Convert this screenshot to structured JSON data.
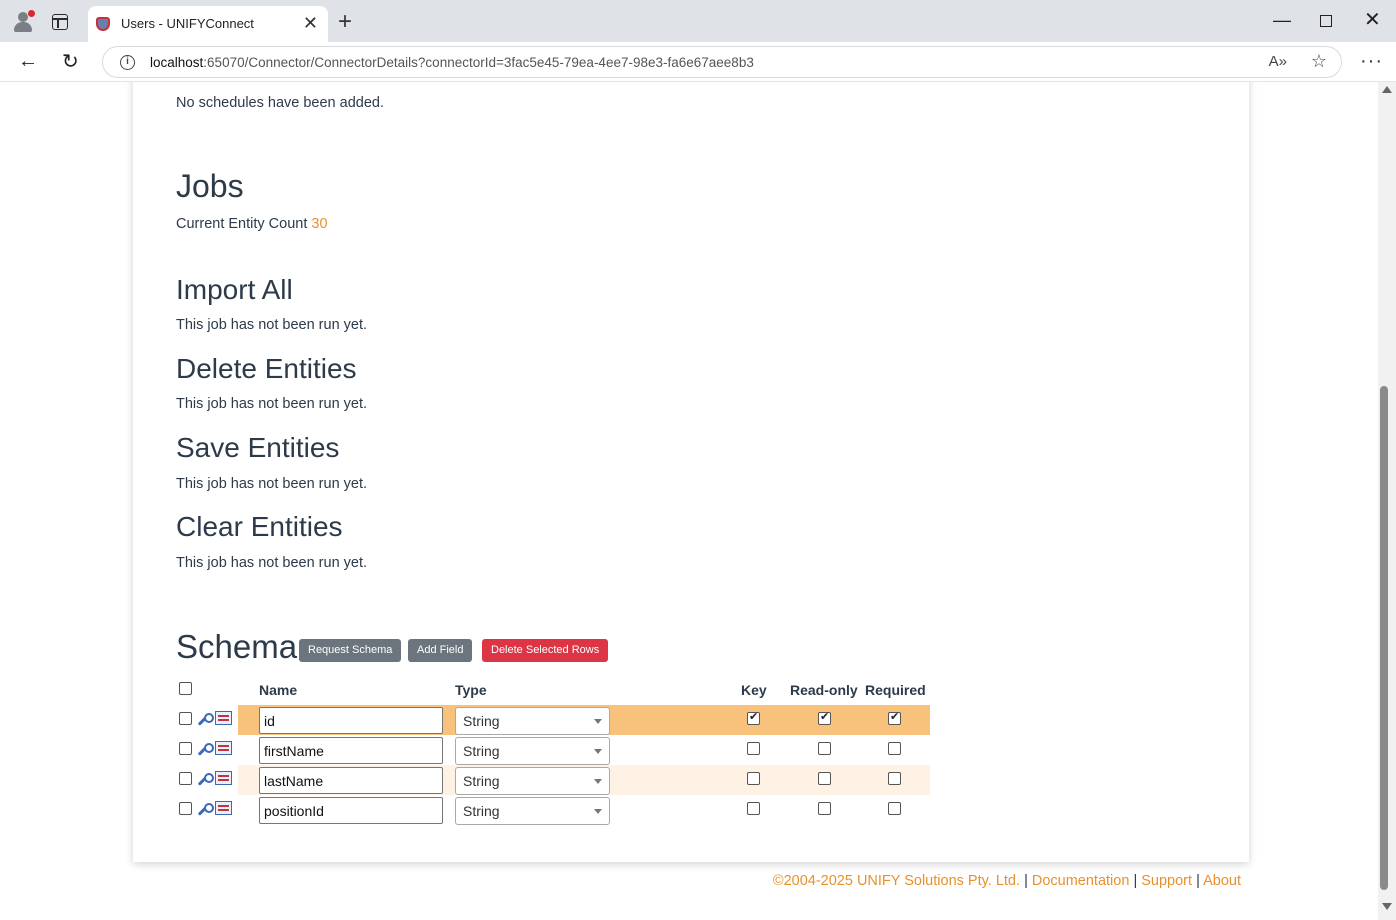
{
  "browser": {
    "tab_title": "Users - UNIFYConnect",
    "url_host": "localhost",
    "url_rest": ":65070/Connector/ConnectorDetails?connectorId=3fac5e45-79ea-4ee7-98e3-fa6e67aee8b3"
  },
  "schedules": {
    "empty_text": "No schedules have been added."
  },
  "jobs": {
    "heading": "Jobs",
    "entity_count_label": "Current Entity Count",
    "entity_count_value": "30",
    "items": [
      {
        "title": "Import All",
        "status": "This job has not been run yet."
      },
      {
        "title": "Delete Entities",
        "status": "This job has not been run yet."
      },
      {
        "title": "Save Entities",
        "status": "This job has not been run yet."
      },
      {
        "title": "Clear Entities",
        "status": "This job has not been run yet."
      }
    ]
  },
  "schema": {
    "heading": "Schema",
    "buttons": {
      "request_schema": "Request Schema",
      "add_field": "Add Field",
      "delete_selected": "Delete Selected Rows"
    },
    "columns": {
      "name": "Name",
      "type": "Type",
      "key": "Key",
      "readonly": "Read-only",
      "required": "Required"
    },
    "rows": [
      {
        "name": "id",
        "type": "String",
        "key": true,
        "readonly": true,
        "required": true,
        "selected": false
      },
      {
        "name": "firstName",
        "type": "String",
        "key": false,
        "readonly": false,
        "required": false,
        "selected": false
      },
      {
        "name": "lastName",
        "type": "String",
        "key": false,
        "readonly": false,
        "required": false,
        "selected": false
      },
      {
        "name": "positionId",
        "type": "String",
        "key": false,
        "readonly": false,
        "required": false,
        "selected": false
      }
    ]
  },
  "footer": {
    "copyright": "©2004-2025 UNIFY Solutions Pty. Ltd.",
    "sep": "|",
    "documentation": "Documentation",
    "support": "Support",
    "about": "About"
  },
  "colors": {
    "accent": "#e8912b",
    "danger": "#dc3545",
    "secondary": "#6c757d",
    "row_highlight": "#f9c27c",
    "row_alt": "#fdf2e4"
  }
}
